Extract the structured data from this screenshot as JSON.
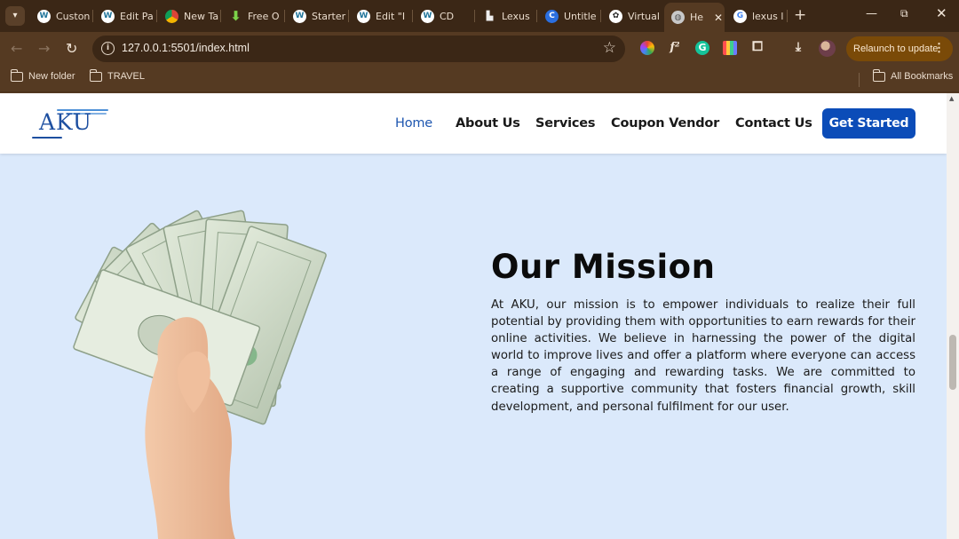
{
  "browser": {
    "tabs": [
      {
        "label": "Custon",
        "icon": "wordpress-icon"
      },
      {
        "label": "Edit Pa",
        "icon": "wordpress-icon"
      },
      {
        "label": "New Ta",
        "icon": "chrome-icon"
      },
      {
        "label": "Free O",
        "icon": "download-arrow-icon"
      },
      {
        "label": "Starter",
        "icon": "wordpress-icon"
      },
      {
        "label": "Edit \"I",
        "icon": "wordpress-icon"
      },
      {
        "label": "CD",
        "icon": "wordpress-icon"
      },
      {
        "label": "Lexus",
        "icon": "lexus-icon"
      },
      {
        "label": "Untitle",
        "icon": "canva-icon"
      },
      {
        "label": "Virtual",
        "icon": "chatgpt-icon"
      },
      {
        "label": "He",
        "icon": "globe-icon",
        "active": true
      },
      {
        "label": "lexus l",
        "icon": "google-icon"
      }
    ],
    "new_tab": "+",
    "url": "127.0.0.1:5501/index.html",
    "relaunch_label": "Relaunch to update",
    "bookmarks": [
      "New folder",
      "TRAVEL"
    ],
    "all_bookmarks": "All Bookmarks",
    "colors": {
      "chrome_bg": "#553a22",
      "tabstrip_bg": "#3b2716",
      "relaunch_bg": "#7a4a08"
    }
  },
  "site": {
    "logo": "AKU",
    "nav": {
      "home": "Home",
      "about": "About Us",
      "services": "Services",
      "coupon": "Coupon Vendor",
      "contact": "Contact Us",
      "cta": "Get Started"
    },
    "mission": {
      "title": "Our Mission",
      "body": "At AKU, our mission is to empower individuals to realize their full potential by providing them with opportunities to earn rewards for their online activities. We believe in harnessing the power of the digital world to improve lives and offer a platform where everyone can access a range of engaging and rewarding tasks. We are committed to creating a supportive community that fosters financial growth, skill development, and personal fulfilment for our user."
    },
    "colors": {
      "page_bg": "#dbe9fb",
      "accent": "#0b4cb8",
      "nav_active": "#1f57b0"
    }
  }
}
